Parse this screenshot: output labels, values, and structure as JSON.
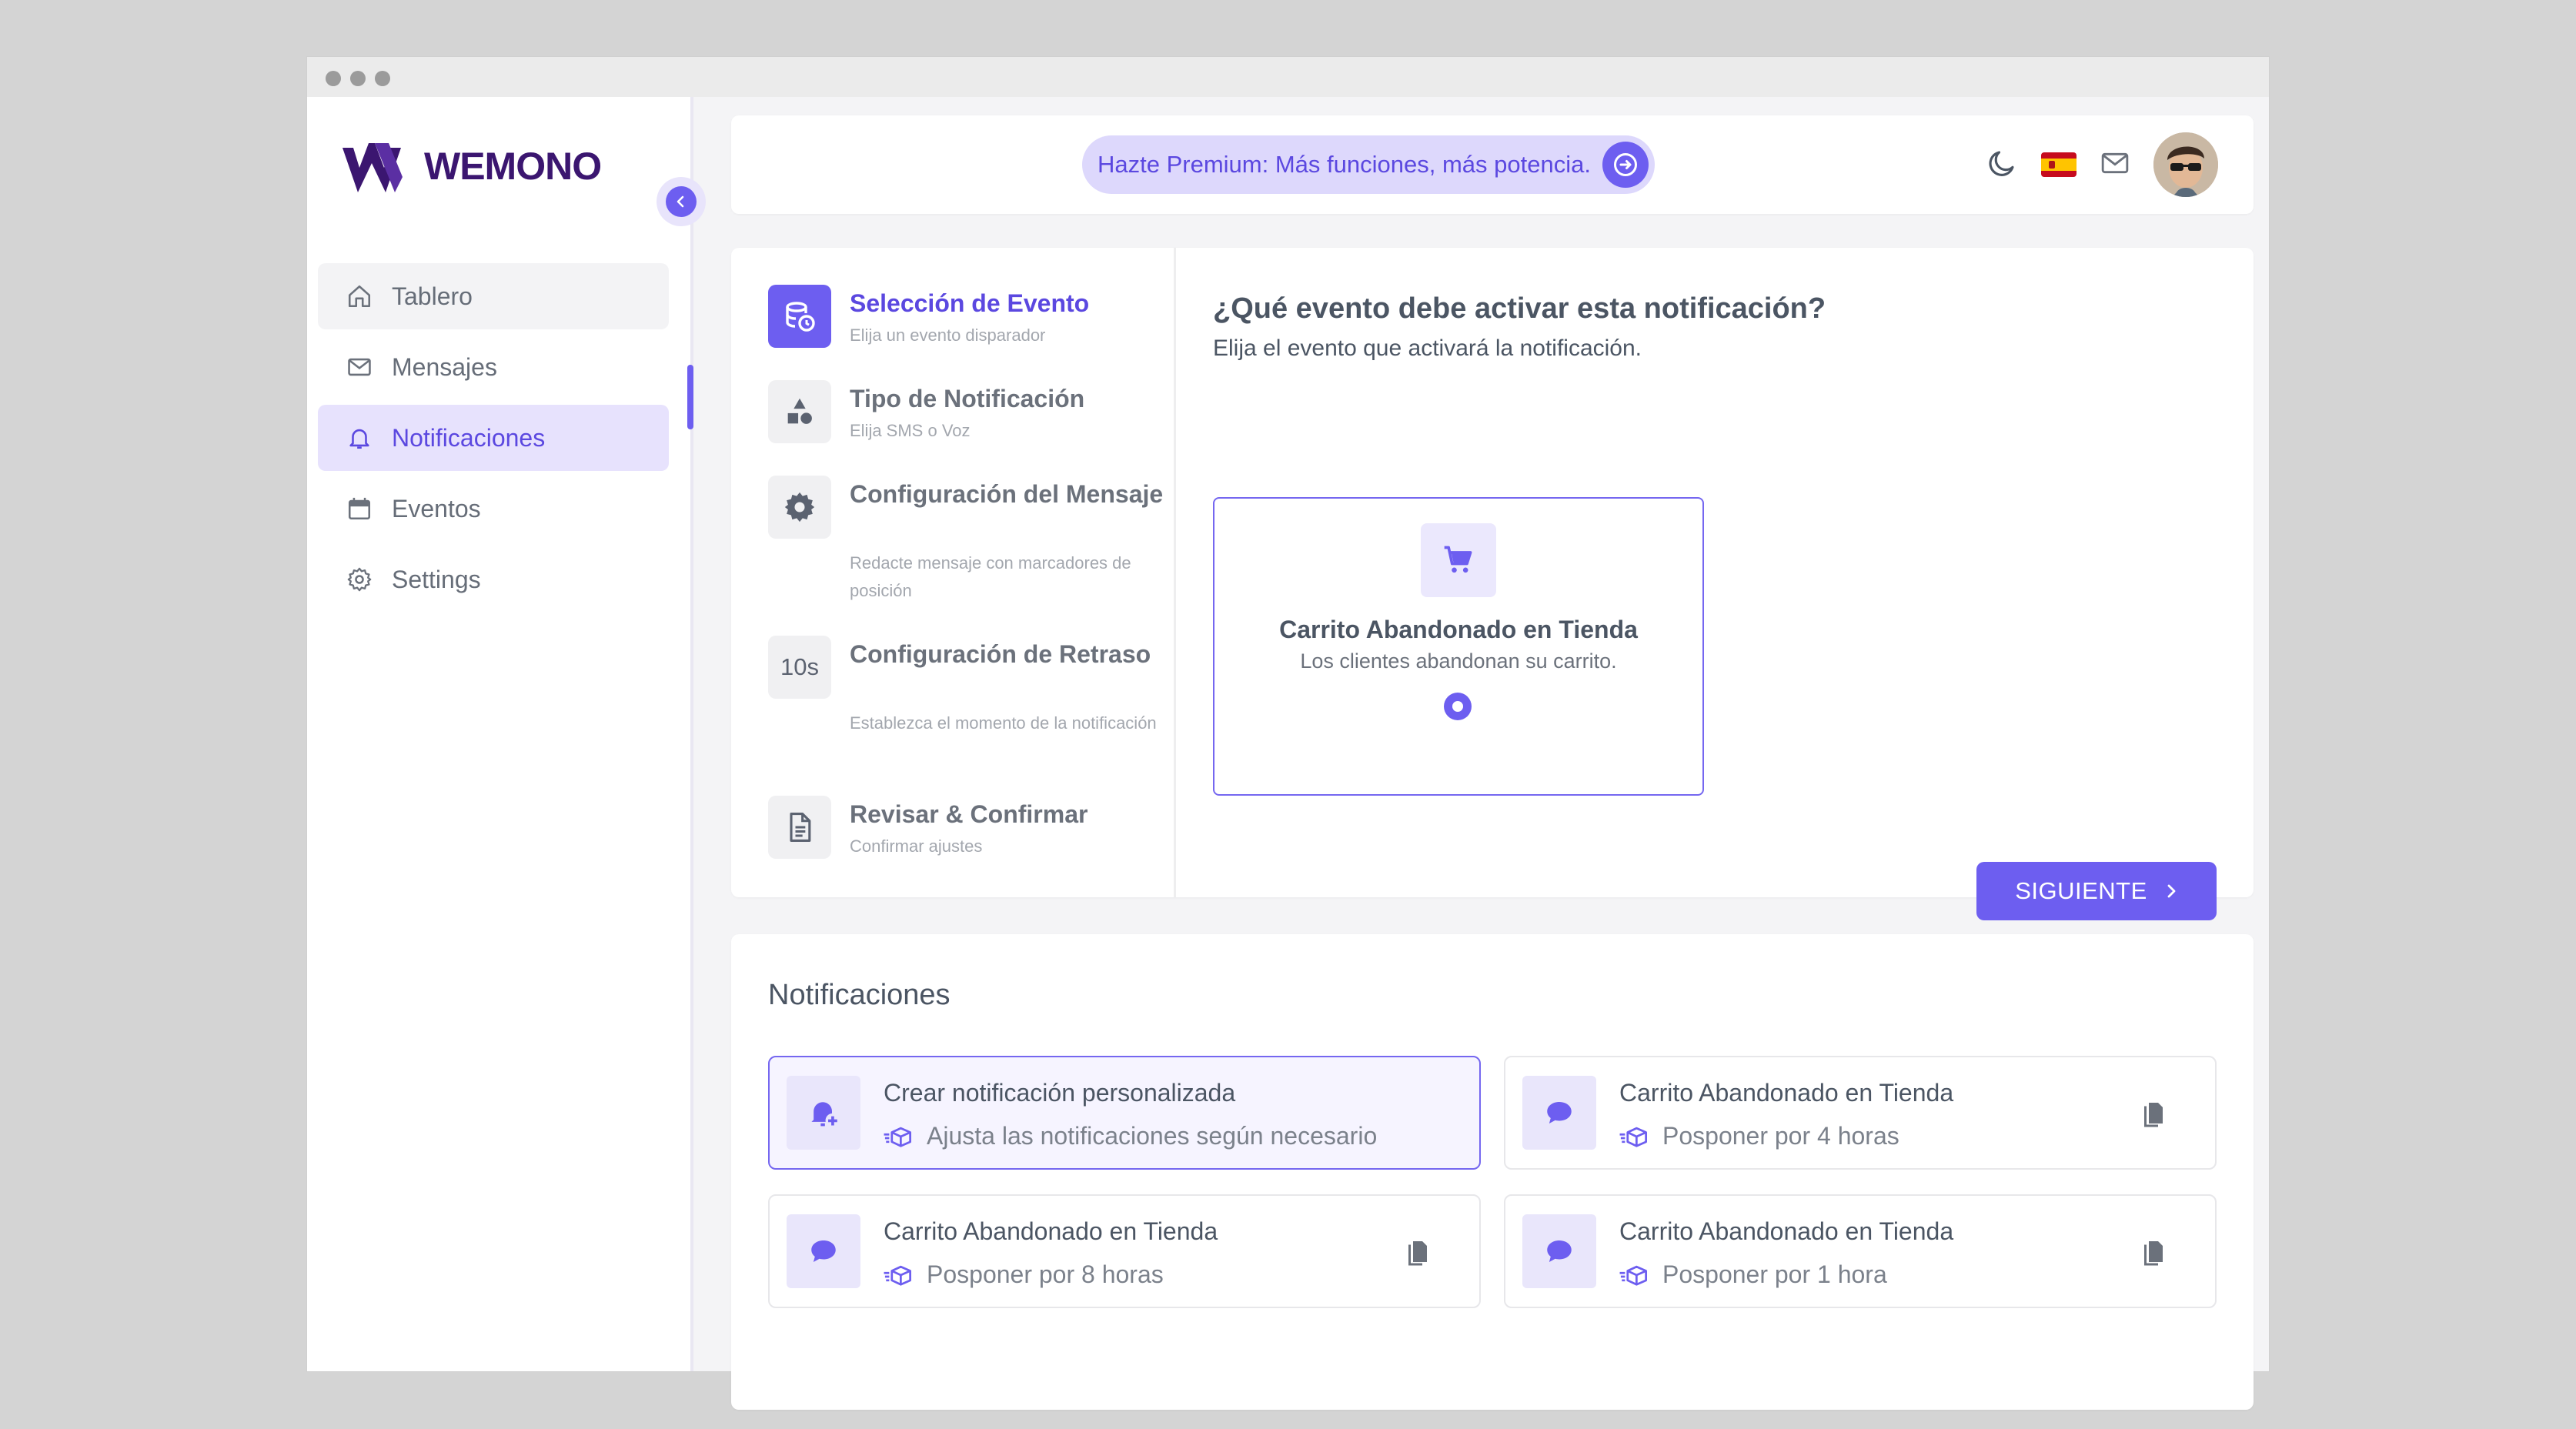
{
  "app": {
    "logo_text": "WEMONO"
  },
  "sidebar": {
    "items": [
      {
        "label": "Tablero",
        "icon": "home-icon"
      },
      {
        "label": "Mensajes",
        "icon": "mail-icon"
      },
      {
        "label": "Notificaciones",
        "icon": "bell-icon",
        "active": true
      },
      {
        "label": "Eventos",
        "icon": "calendar-icon"
      },
      {
        "label": "Settings",
        "icon": "gear-icon"
      }
    ]
  },
  "topbar": {
    "premium_text": "Hazte Premium: Más funciones, más potencia.",
    "icons": [
      "moon-icon",
      "spain-flag-icon",
      "mail-icon",
      "avatar"
    ]
  },
  "wizard": {
    "steps": [
      {
        "title": "Selección de Evento",
        "subtitle": "Elija un evento disparador",
        "icon": "database-clock-icon",
        "active": true
      },
      {
        "title": "Tipo de Notificación",
        "subtitle": "Elija SMS o Voz",
        "icon": "shapes-icon"
      },
      {
        "title": "Configuración del Mensaje",
        "subtitle": "Redacte mensaje con marcadores de posición",
        "icon": "gear-icon"
      },
      {
        "title": "Configuración de Retraso",
        "subtitle": "Establezca el momento de la notificación",
        "icon_text": "10s"
      },
      {
        "title": "Revisar & Confirmar",
        "subtitle": "Confirmar ajustes",
        "icon": "document-icon"
      }
    ],
    "question_title": "¿Qué evento debe activar esta notificación?",
    "question_subtitle": "Elija el evento que activará la notificación.",
    "event_option": {
      "title": "Carrito Abandonado en Tienda",
      "subtitle": "Los clientes abandonan su carrito.",
      "icon": "cart-icon",
      "selected": true
    },
    "next_label": "SIGUIENTE"
  },
  "notifications": {
    "heading": "Notificaciones",
    "items": [
      {
        "title": "Crear notificación personalizada",
        "subtitle": "Ajusta las notificaciones según necesario",
        "icon": "bell-plus-icon"
      },
      {
        "title": "Carrito Abandonado en Tienda",
        "subtitle": "Posponer por 4 horas",
        "icon": "chat-bubble-icon"
      },
      {
        "title": "Carrito Abandonado en Tienda",
        "subtitle": "Posponer por 8 horas",
        "icon": "chat-bubble-icon"
      },
      {
        "title": "Carrito Abandonado en Tienda",
        "subtitle": "Posponer por 1 hora",
        "icon": "chat-bubble-icon"
      }
    ]
  },
  "colors": {
    "accent": "#6d5ef0",
    "accent_light": "#e7e2fd",
    "brand": "#3b1670"
  }
}
